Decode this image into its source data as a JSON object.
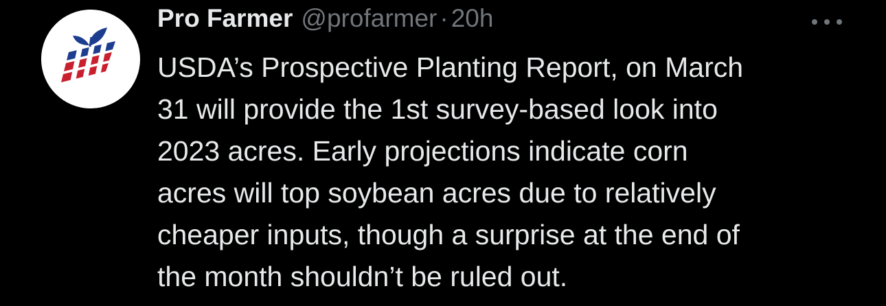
{
  "tweet": {
    "display_name": "Pro Farmer",
    "handle": "@profarmer",
    "separator": "·",
    "time": "20h",
    "text": "USDA’s Prospective Planting Report, on March\n31 will provide the 1st survey-based look into\n2023 acres. Early projections indicate corn\nacres will top soybean acres due to relatively\ncheaper inputs, though a surprise at the end of\nthe month shouldn’t be ruled out.",
    "more_icon": "more-horizontal-icon",
    "avatar_logo": "pro-farmer-logo"
  },
  "colors": {
    "background": "#000000",
    "primary_text": "#e7e9ea",
    "secondary_text": "#71767b",
    "logo_blue": "#1d3d8f",
    "logo_red": "#c8202f"
  }
}
